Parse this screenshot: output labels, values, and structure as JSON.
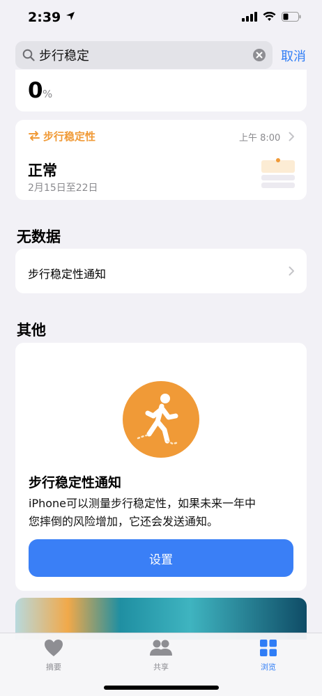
{
  "status_bar": {
    "time": "2:39"
  },
  "search": {
    "query": "步行稳定",
    "cancel_label": "取消"
  },
  "summary_card": {
    "value": "0",
    "unit": "%"
  },
  "metric_card": {
    "title": "步行稳定性",
    "time": "上午 8:00",
    "value": "正常",
    "date_range": "2月15日至22日",
    "accent_color": "#f09a37"
  },
  "no_data_section": {
    "heading": "无数据",
    "items": [
      {
        "label": "步行稳定性通知"
      }
    ]
  },
  "other_section": {
    "heading": "其他",
    "info_card": {
      "title": "步行稳定性通知",
      "description_line1": "iPhone可以测量步行稳定性，如果未来一年中",
      "description_line2": "您摔倒的风险增加，它还会发送通知。",
      "button_label": "设置",
      "icon": "walking-person-icon"
    }
  },
  "tab_bar": {
    "tabs": [
      {
        "label": "摘要",
        "icon": "heart-icon",
        "active": false
      },
      {
        "label": "共享",
        "icon": "people-icon",
        "active": false
      },
      {
        "label": "浏览",
        "icon": "grid-icon",
        "active": true
      }
    ],
    "active_color": "#2f7df6"
  }
}
